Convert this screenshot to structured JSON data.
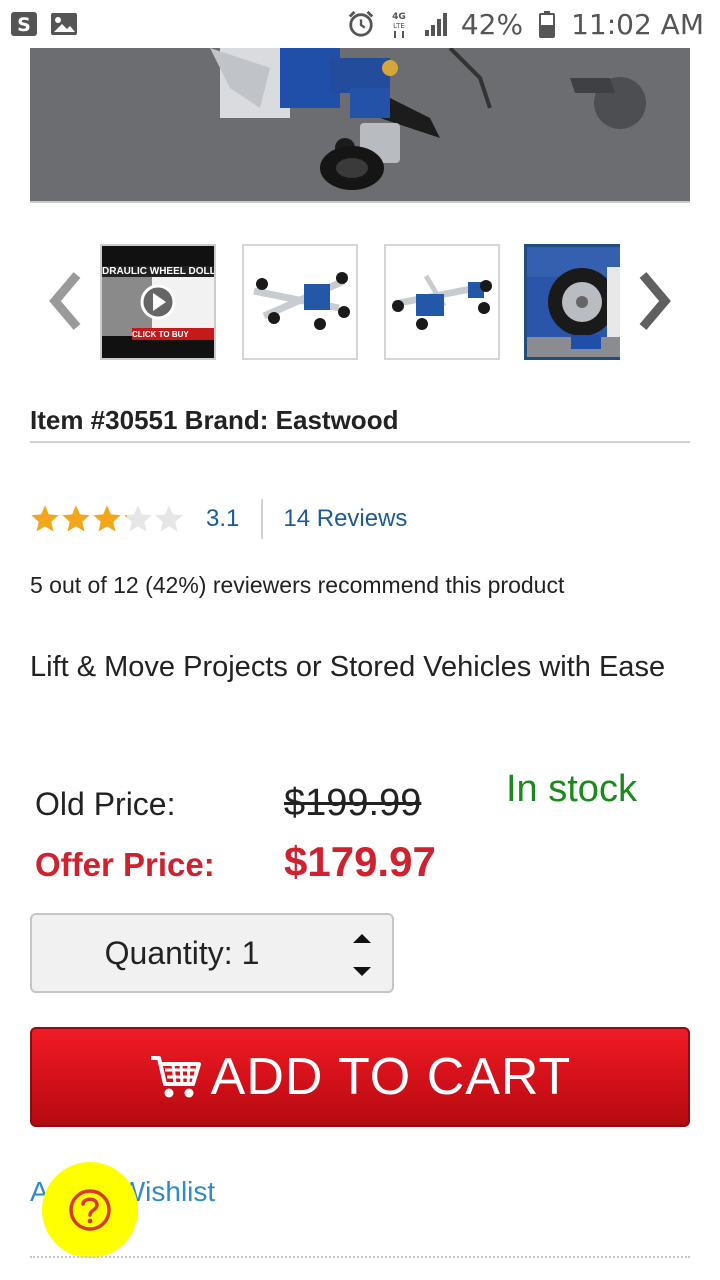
{
  "status_bar": {
    "left_icons": [
      "s-app-icon",
      "gallery-icon"
    ],
    "right_icons": [
      "alarm-icon",
      "4g-lte-icon",
      "signal-icon",
      "battery-icon"
    ],
    "battery": "42%",
    "time": "11:02 AM"
  },
  "gallery": {
    "main_image_alt": "hydraulic wheel dolly under car wheel",
    "prev_icon": "chevron-left-icon",
    "next_icon": "chevron-right-icon",
    "thumbnails": [
      {
        "kind": "video",
        "title": "DRAULIC WHEEL DOLL",
        "button": "CLICK TO BUY"
      },
      {
        "kind": "image"
      },
      {
        "kind": "image"
      },
      {
        "kind": "image",
        "selected": true
      }
    ]
  },
  "product": {
    "item_line": "Item #30551 Brand: Eastwood",
    "rating_value": "3.1",
    "rating_fraction": 0.62,
    "reviews": "14 Reviews",
    "recommend": "5 out of 12 (42%) reviewers recommend this product",
    "tagline": "Lift & Move Projects or Stored Vehicles with Ease"
  },
  "pricing": {
    "old_label": "Old Price:",
    "old_value": "$199.99",
    "offer_label": "Offer Price:",
    "offer_value": "$179.97",
    "stock": "In stock"
  },
  "quantity": {
    "label": "Quantity: 1"
  },
  "cart": {
    "label": "ADD TO CART"
  },
  "wishlist": {
    "label": "Add to Wishlist"
  },
  "colors": {
    "accent_red": "#d1202e",
    "link_blue": "#1d5a96",
    "stock_green": "#1a8a1a",
    "fab_yellow": "#ffff00"
  }
}
